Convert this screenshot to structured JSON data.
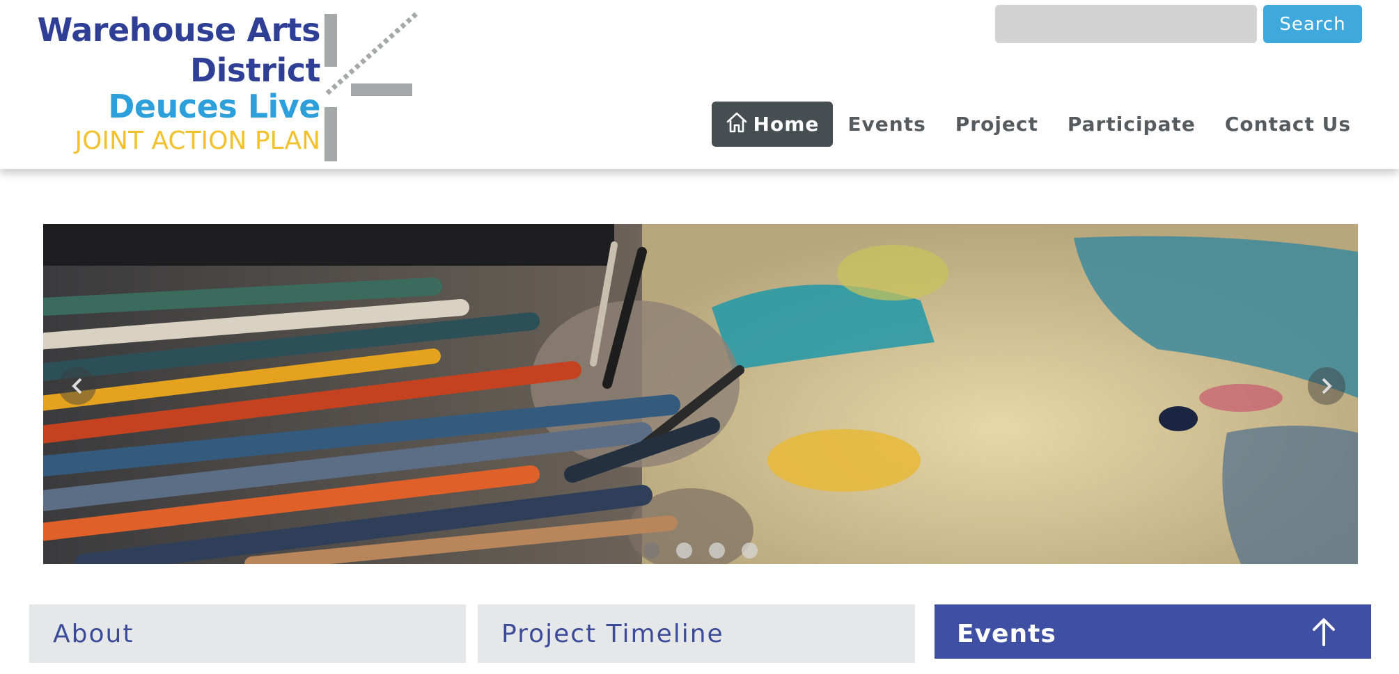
{
  "logo": {
    "line1": "Warehouse Arts",
    "line2": "District",
    "line3": "Deuces Live",
    "line4": "JOINT ACTION PLAN",
    "colors": {
      "navy": "#2f3f95",
      "sky": "#2d9fdb",
      "gold": "#f2c12e",
      "gray": "#a6a7a9"
    }
  },
  "search": {
    "placeholder": "",
    "value": "",
    "button_label": "Search",
    "button_color": "#3fa9de"
  },
  "nav": {
    "items": [
      {
        "label": "Home",
        "icon": "home-icon",
        "active": true
      },
      {
        "label": "Events"
      },
      {
        "label": "Project"
      },
      {
        "label": "Participate"
      },
      {
        "label": "Contact Us"
      }
    ],
    "active_bg": "#474e52"
  },
  "carousel": {
    "slide_count": 4,
    "active_slide": 1,
    "prev_icon": "chevron-left-icon",
    "next_icon": "chevron-right-icon"
  },
  "panels": {
    "about": {
      "title": "About"
    },
    "timeline": {
      "title": "Project Timeline"
    },
    "events": {
      "title": "Events",
      "icon": "arrow-up-icon",
      "bg": "#3f4fa3"
    }
  }
}
